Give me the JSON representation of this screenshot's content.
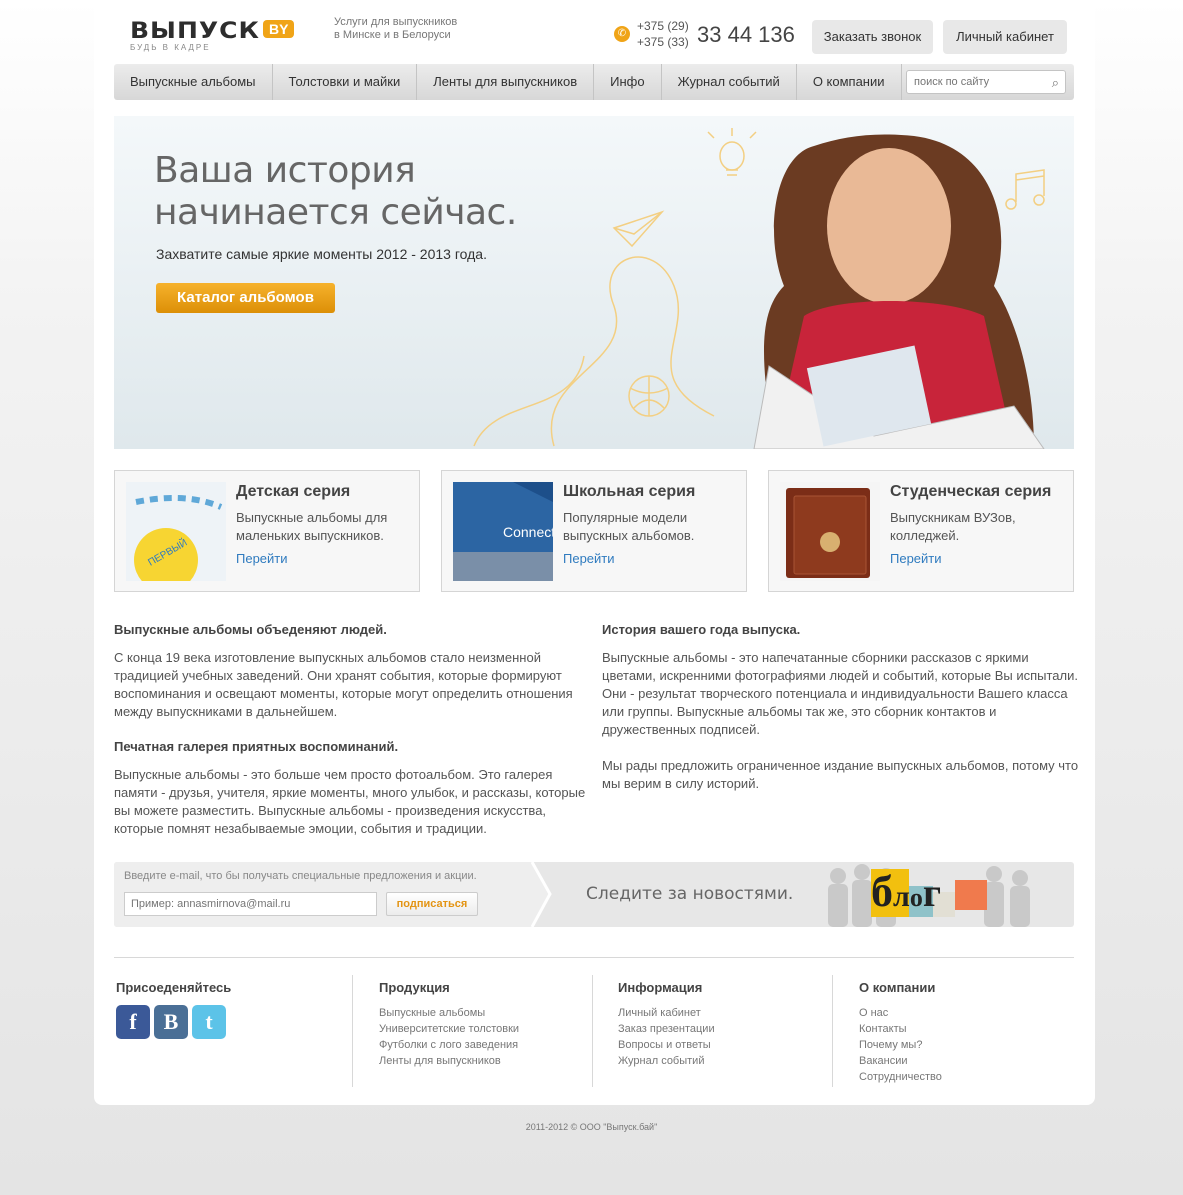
{
  "header": {
    "logo_text": "ВЫПУСК",
    "logo_badge": "BY",
    "logo_slogan": "БУДЬ В КАДРЕ",
    "tagline_line1": "Услуги для выпускников",
    "tagline_line2": "в Минске и в Белоруси",
    "phone_code1": "+375 (29)",
    "phone_code2": "+375 (33)",
    "phone_number": "33 44 136",
    "call_button": "Заказать звонок",
    "cabinet_button": "Личный кабинет"
  },
  "nav": {
    "items": [
      "Выпускные альбомы",
      "Толстовки и майки",
      "Ленты для выпускников",
      "Инфо",
      "Журнал событий",
      "О компании"
    ],
    "search_placeholder": "поиск по сайту"
  },
  "hero": {
    "title": "Ваша история начинается сейчас.",
    "subtitle": "Захватите самые яркие моменты 2012 - 2013 года.",
    "button": "Каталог альбомов"
  },
  "series": [
    {
      "title": "Детская серия",
      "text": "Выпускные альбомы для маленьких выпускников.",
      "link": "Перейти"
    },
    {
      "title": "Школьная серия",
      "text": "Популярные модели выпускных альбомов.",
      "link": "Перейти"
    },
    {
      "title": "Студенческая серия",
      "text": "Выпускникам ВУЗов, колледжей.",
      "link": "Перейти"
    }
  ],
  "articles": {
    "left": [
      {
        "heading": "Выпускные альбомы объеденяют людей.",
        "text": "С конца 19 века изготовление выпускных альбомов стало неизменной традицией учебных заведений. Они хранят события, которые формируют воспоминания и освещают моменты, которые могут определить отношения между выпускниками в дальнейшем."
      },
      {
        "heading": "Печатная галерея приятных воспоминаний.",
        "text": "Выпускные альбомы - это больше чем просто фотоальбом. Это галерея памяти - друзья, учителя, яркие моменты, много улыбок, и рассказы, которые вы можете разместить. Выпускные альбомы - произведения искусства, которые помнят незабываемые эмоции, события и традиции."
      }
    ],
    "right": {
      "heading": "История вашего года выпуска.",
      "paragraphs": [
        "Выпускные альбомы - это напечатанные сборники рассказов с яркими цветами, искренними фотографиями людей и событий, которые Вы испытали. Они - результат творческого потенциала и индивидуальности Вашего класса или группы. Выпускные альбомы  так же, это сборник контактов  и дружественных подписей.",
        "Мы рады предложить ограниченное издание выпускных альбомов, потому что мы верим в силу историй."
      ]
    }
  },
  "subscribe": {
    "hint": "Введите e-mail, что бы получать специальные предложения и акции.",
    "placeholder": "Пример: annasmirnova@mail.ru",
    "button": "подписаться",
    "news_text": "Следите за новостями.",
    "blog_letters": [
      "б",
      "л",
      "о",
      "г"
    ]
  },
  "footer": {
    "join_title": "Присоеденяйтесь",
    "social": [
      {
        "icon": "facebook-icon",
        "glyph": "f",
        "color": "#3b5998"
      },
      {
        "icon": "vkontakte-icon",
        "glyph": "B",
        "color": "#4a6f96"
      },
      {
        "icon": "twitter-icon",
        "glyph": "t",
        "color": "#5cc3e8"
      }
    ],
    "columns": [
      {
        "title": "Продукция",
        "links": [
          "Выпускные альбомы",
          "Университетские толстовки",
          "Футболки с лого заведения",
          "Ленты для выпускников"
        ]
      },
      {
        "title": "Информация",
        "links": [
          "Личный кабинет",
          "Заказ презентации",
          "Вопросы и ответы",
          "Журнал событий"
        ]
      },
      {
        "title": "О компании",
        "links": [
          "О нас",
          "Контакты",
          "Почему мы?",
          "Вакансии",
          "Сотрудничество"
        ]
      }
    ],
    "copyright": "2011-2012  ©  ООО \"Выпуск.бай\""
  },
  "colors": {
    "accent": "#f0a417",
    "link": "#2f7bbf"
  }
}
